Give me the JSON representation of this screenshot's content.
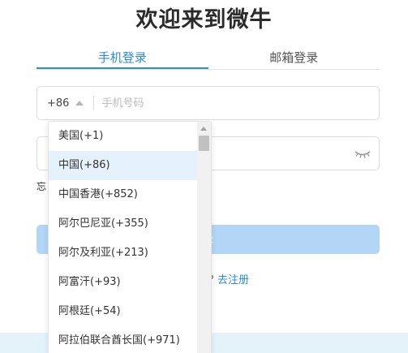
{
  "page": {
    "title": "欢迎来到微牛"
  },
  "tabs": [
    {
      "label": "手机登录",
      "active": true
    },
    {
      "label": "邮箱登录",
      "active": false
    }
  ],
  "phone": {
    "country_code": "+86",
    "placeholder": "手机号码"
  },
  "password": {
    "value": ""
  },
  "forgot": {
    "label": "忘"
  },
  "login": {
    "label": "录"
  },
  "register": {
    "prompt": "? ",
    "link": "去注册"
  },
  "dropdown": {
    "items": [
      "美国(+1)",
      "中国(+86)",
      "中国香港(+852)",
      "阿尔巴尼亚(+355)",
      "阿尔及利亚(+213)",
      "阿富汗(+93)",
      "阿根廷(+54)",
      "阿拉伯联合酋长国(+971)"
    ],
    "selected_index": 1
  },
  "colors": {
    "accent": "#2b8be0",
    "button_disabled": "#b3d6f7",
    "selected_bg": "#e5f2fc"
  }
}
